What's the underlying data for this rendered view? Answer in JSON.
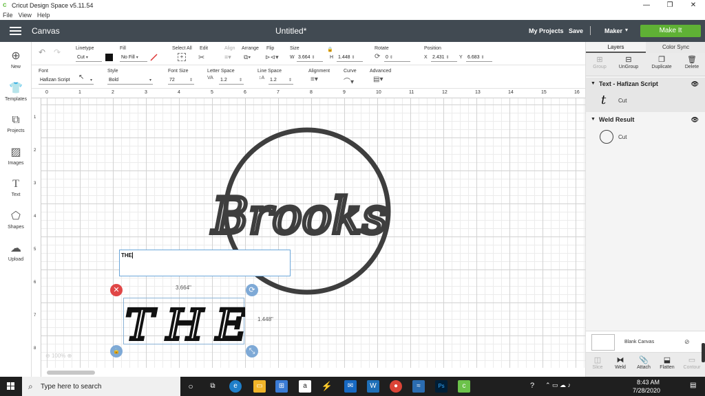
{
  "window": {
    "title": "Cricut Design Space  v5.11.54",
    "controls": [
      "—",
      "❐",
      "✕"
    ]
  },
  "menu": [
    "File",
    "View",
    "Help"
  ],
  "header": {
    "section": "Canvas",
    "doc_title": "Untitled*",
    "my_projects": "My Projects",
    "save": "Save",
    "machine": "Maker",
    "make_it": "Make It"
  },
  "sidebar": [
    {
      "label": "New",
      "icon": "plus-circle-icon"
    },
    {
      "label": "Templates",
      "icon": "shirt-icon"
    },
    {
      "label": "Projects",
      "icon": "projects-icon"
    },
    {
      "label": "Images",
      "icon": "image-icon"
    },
    {
      "label": "Text",
      "icon": "text-icon"
    },
    {
      "label": "Shapes",
      "icon": "shapes-icon"
    },
    {
      "label": "Upload",
      "icon": "cloud-upload-icon"
    }
  ],
  "toolbar1": {
    "linetype_label": "Linetype",
    "linetype_value": "Cut",
    "fill_label": "Fill",
    "fill_value": "No Fill",
    "select_all": "Select All",
    "edit": "Edit",
    "align": "Align",
    "arrange": "Arrange",
    "flip": "Flip",
    "size": "Size",
    "w_label": "W",
    "w_value": "3.664",
    "h_label": "H",
    "h_value": "1.448",
    "rotate": "Rotate",
    "rotate_value": "0",
    "position": "Position",
    "x_label": "X",
    "x_value": "2.431",
    "y_label": "Y",
    "y_value": "6.683",
    "fill_color": "#111111"
  },
  "toolbar2": {
    "font_label": "Font",
    "font_value": "Hafizan Script",
    "style_label": "Style",
    "style_value": "Bold",
    "font_size_label": "Font Size",
    "font_size_value": "72",
    "letter_space_label": "Letter Space",
    "letter_space_value": "1.2",
    "line_space_label": "Line Space",
    "line_space_value": "1.2",
    "alignment_label": "Alignment",
    "curve_label": "Curve",
    "advanced_label": "Advanced"
  },
  "ruler": {
    "top": [
      "0",
      "1",
      "2",
      "3",
      "4",
      "5",
      "6",
      "7",
      "8",
      "9",
      "10",
      "11",
      "12",
      "13",
      "14",
      "15",
      "16"
    ],
    "left": [
      "1",
      "2",
      "3",
      "4",
      "5",
      "6",
      "7",
      "8"
    ]
  },
  "canvas": {
    "design_text": "Brooks",
    "edit_text": "THE",
    "selected_text": "THE",
    "width_dim": "3.664\"",
    "height_dim": "1.448\"",
    "zoom": "100%"
  },
  "layers_panel": {
    "tabs": [
      "Layers",
      "Color Sync"
    ],
    "actions": [
      {
        "label": "Group",
        "enabled": false
      },
      {
        "label": "UnGroup",
        "enabled": true
      },
      {
        "label": "Duplicate",
        "enabled": true
      },
      {
        "label": "Delete",
        "enabled": true
      }
    ],
    "groups": [
      {
        "name": "Text - Hafizan Script",
        "item": "Cut"
      },
      {
        "name": "Weld Result",
        "item": "Cut"
      }
    ],
    "blank_canvas": "Blank Canvas",
    "bottom_actions": [
      {
        "label": "Slice",
        "enabled": false
      },
      {
        "label": "Weld",
        "enabled": true
      },
      {
        "label": "Attach",
        "enabled": true
      },
      {
        "label": "Flatten",
        "enabled": true
      },
      {
        "label": "Contour",
        "enabled": false
      }
    ]
  },
  "taskbar": {
    "search_placeholder": "Type here to search",
    "time": "8:43 AM",
    "date": "7/28/2020"
  }
}
